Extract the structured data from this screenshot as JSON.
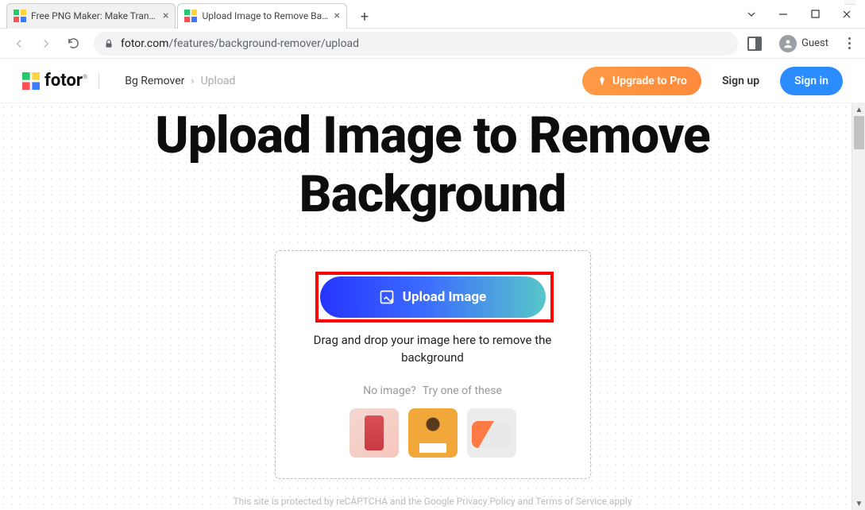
{
  "browser": {
    "tabs": [
      {
        "title": "Free PNG Maker: Make Transp"
      },
      {
        "title": "Upload Image to Remove Back"
      }
    ],
    "url_domain": "fotor.com",
    "url_path": "/features/background-remover/upload",
    "guest": "Guest"
  },
  "header": {
    "logo_text": "fotor",
    "breadcrumb1": "Bg Remover",
    "breadcrumb2": "Upload",
    "upgrade": "Upgrade to Pro",
    "signup": "Sign up",
    "signin": "Sign in"
  },
  "hero": {
    "title_line1": "Upload Image to Remove",
    "title_line2": "Background"
  },
  "dropbox": {
    "upload_button": "Upload Image",
    "drop_text": "Drag and drop your image here to remove the background",
    "no_image": "No image?",
    "try_text": "Try one of these"
  },
  "footer": {
    "note": "This site is protected by reCAPTCHA and the Google Privacy Policy and Terms of Service apply"
  }
}
